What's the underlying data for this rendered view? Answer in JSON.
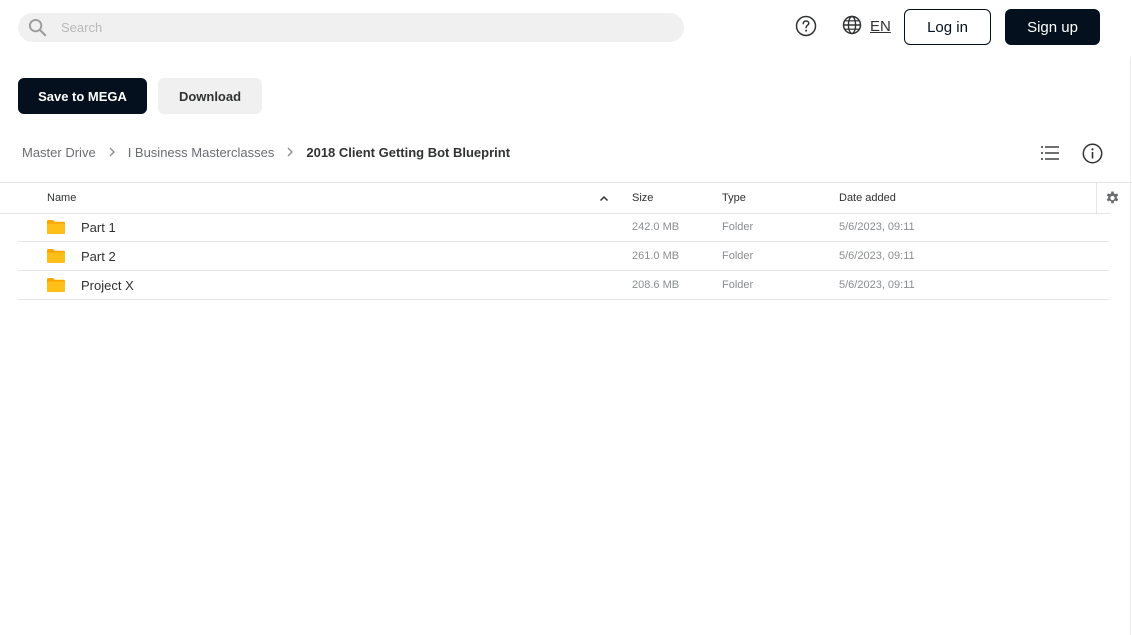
{
  "header": {
    "search_placeholder": "Search",
    "language": "EN",
    "login_label": "Log in",
    "signup_label": "Sign up"
  },
  "actions": {
    "save_label": "Save to MEGA",
    "download_label": "Download"
  },
  "breadcrumb": {
    "items": [
      "Master Drive",
      "I Business Masterclasses"
    ],
    "current": "2018 Client Getting Bot Blueprint"
  },
  "table": {
    "columns": {
      "name": "Name",
      "size": "Size",
      "type": "Type",
      "date": "Date added"
    },
    "sort": "ascending",
    "rows": [
      {
        "name": "Part 1",
        "size": "242.0 MB",
        "type": "Folder",
        "date": "5/6/2023, 09:11"
      },
      {
        "name": "Part 2",
        "size": "261.0 MB",
        "type": "Folder",
        "date": "5/6/2023, 09:11"
      },
      {
        "name": "Project X",
        "size": "208.6 MB",
        "type": "Folder",
        "date": "5/6/2023, 09:11"
      }
    ]
  },
  "colors": {
    "primary": "#04101e",
    "folder": "#ffb90f",
    "folder_tab": "#f9a602",
    "border": "#e5e5e5"
  },
  "icons": [
    "search-icon",
    "help-icon",
    "globe-icon",
    "chevron-right-icon",
    "list-view-icon",
    "info-icon",
    "sort-up-icon",
    "gear-icon",
    "folder-icon"
  ]
}
